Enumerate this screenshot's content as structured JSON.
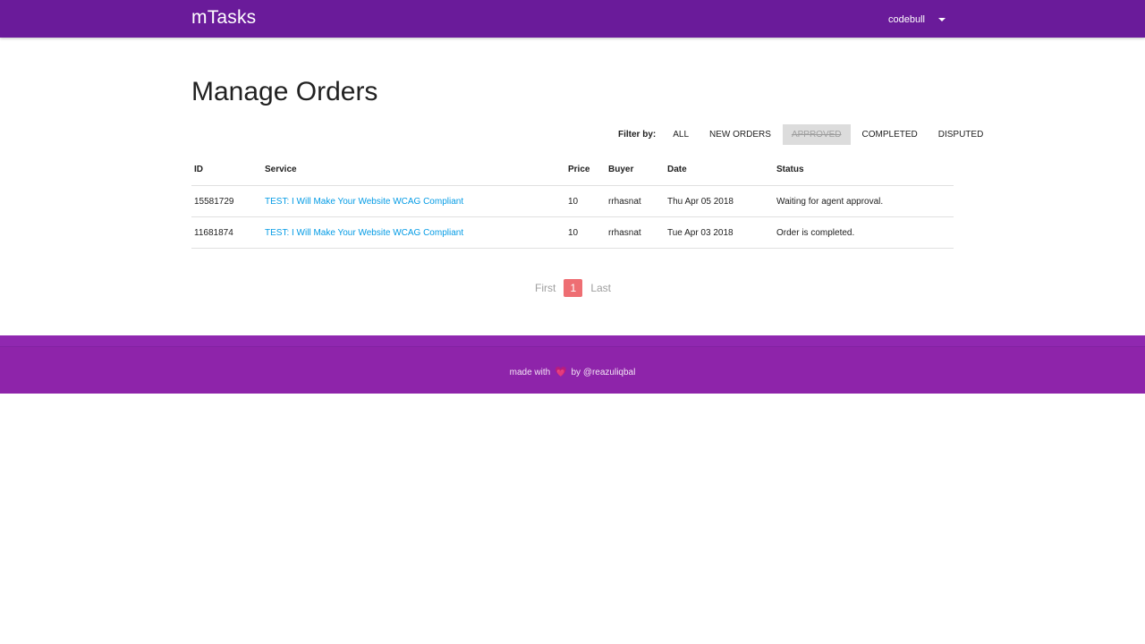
{
  "navbar": {
    "brand": "mTasks",
    "username": "codebull",
    "color": "#6a1b9a"
  },
  "page": {
    "title": "Manage Orders"
  },
  "filter": {
    "label": "Filter by:",
    "options": [
      {
        "label": "ALL",
        "active": false
      },
      {
        "label": "NEW ORDERS",
        "active": false
      },
      {
        "label": "APPROVED",
        "active": true
      },
      {
        "label": "COMPLETED",
        "active": false
      },
      {
        "label": "DISPUTED",
        "active": false
      }
    ]
  },
  "table": {
    "columns": [
      "ID",
      "Service",
      "Price",
      "Buyer",
      "Date",
      "Status"
    ],
    "rows": [
      {
        "id": "15581729",
        "service": "TEST: I Will Make Your Website WCAG Compliant",
        "price": "10",
        "buyer": "rrhasnat",
        "date": "Thu Apr 05 2018",
        "status": "Waiting for agent approval."
      },
      {
        "id": "11681874",
        "service": "TEST: I Will Make Your Website WCAG Compliant",
        "price": "10",
        "buyer": "rrhasnat",
        "date": "Tue Apr 03 2018",
        "status": "Order is completed."
      }
    ]
  },
  "pagination": {
    "first": "First",
    "current": "1",
    "last": "Last"
  },
  "footer": {
    "made_with": "made with",
    "heart": "💗",
    "by": "by @reazuliqbal",
    "color": "#8e24aa"
  }
}
